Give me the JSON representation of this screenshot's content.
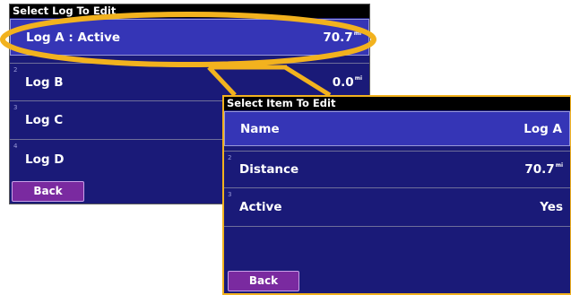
{
  "log_screen": {
    "title": "Select Log To Edit",
    "items": [
      {
        "index": "",
        "label": "Log A : Active",
        "value": "70.7",
        "unit": "mi"
      },
      {
        "index": "2",
        "label": "Log B",
        "value": "0.0",
        "unit": "mi"
      },
      {
        "index": "3",
        "label": "Log C",
        "value": "",
        "unit": ""
      },
      {
        "index": "4",
        "label": "Log D",
        "value": "",
        "unit": ""
      }
    ],
    "back_label": "Back"
  },
  "item_screen": {
    "title": "Select Item To Edit",
    "items": [
      {
        "index": "",
        "label": "Name",
        "value": "Log A",
        "unit": ""
      },
      {
        "index": "2",
        "label": "Distance",
        "value": "70.7",
        "unit": "mi"
      },
      {
        "index": "3",
        "label": "Active",
        "value": "Yes",
        "unit": ""
      }
    ],
    "back_label": "Back"
  },
  "colors": {
    "highlight": "#f2b21e",
    "panel": "#1a1a78",
    "selected_row": "#3535b6",
    "back_button": "#7a2aa0"
  }
}
